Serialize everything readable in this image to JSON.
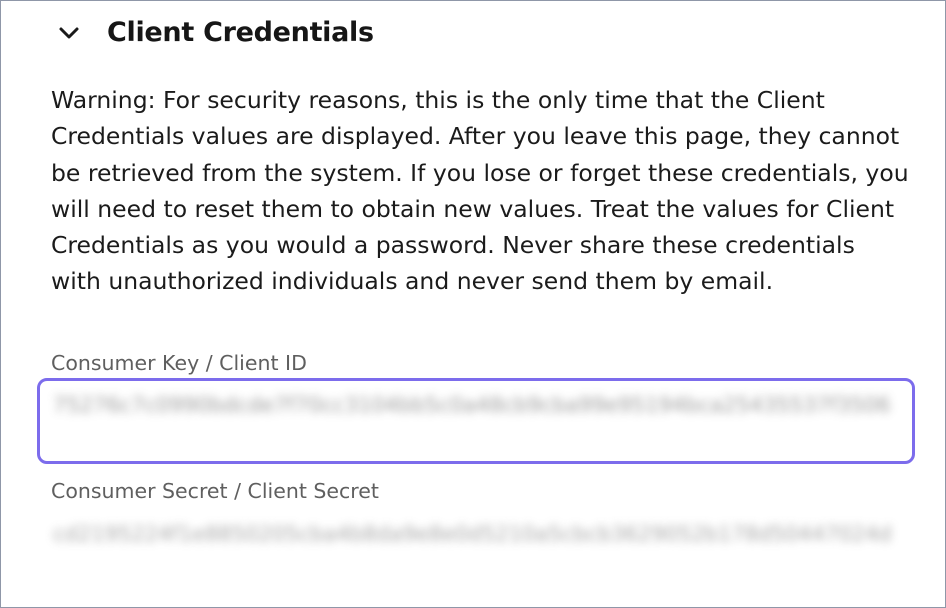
{
  "section": {
    "title": "Client Credentials",
    "toggle_icon": "chevron-down-icon"
  },
  "warning_text": "Warning: For security reasons, this is the only time that the Client Credentials values are displayed. After you leave this page, they cannot be retrieved from the system. If you lose or forget these credentials, you will need to reset them to obtain new values. Treat the values for Client Credentials as you would a password. Never share these credentials with unauthorized individuals and never send them by email.",
  "consumer_key": {
    "label": "Consumer Key / Client ID",
    "value": "75276c7c0990bdcde7f70cc3104bb5c0a48cb9cba99e95194bca25435537f3506"
  },
  "consumer_secret": {
    "label": "Consumer Secret / Client Secret",
    "value": "cd2195224f1e8850205cba4b8da9e8e0d5210a5cbcb3629052b178d50447024d"
  },
  "colors": {
    "focus_border": "#7c6cec",
    "frame_border": "#8f97a8",
    "label_text": "#5f5f5f"
  }
}
